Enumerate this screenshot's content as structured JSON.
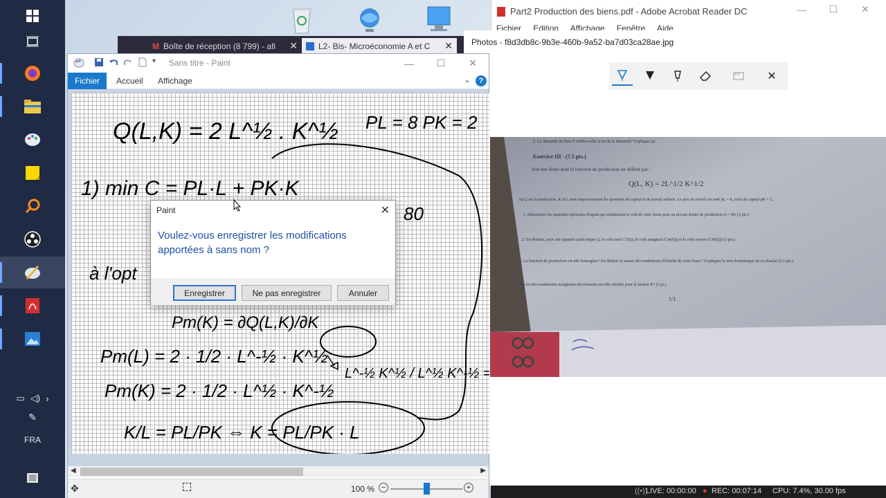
{
  "taskbar": {
    "items": [
      {
        "icon": "windows-start-icon"
      },
      {
        "icon": "task-view-icon"
      },
      {
        "icon": "firefox-icon"
      },
      {
        "icon": "file-explorer-icon"
      },
      {
        "icon": "paint-app-icon"
      },
      {
        "icon": "sticky-notes-icon"
      },
      {
        "icon": "search-magnifier-icon"
      },
      {
        "icon": "obs-studio-icon"
      },
      {
        "icon": "paint-brush-icon"
      },
      {
        "icon": "acrobat-icon"
      },
      {
        "icon": "photos-icon"
      }
    ],
    "language": "FRA"
  },
  "browser": {
    "tabs": [
      {
        "label": "Boîte de réception (8 799) - afi"
      },
      {
        "label": "L2- Bis- Microéconomie A et C"
      }
    ]
  },
  "paint": {
    "title": "Sans titre - Paint",
    "ribbon": {
      "file_label": "Fichier",
      "tabs": [
        "Accueil",
        "Affichage"
      ],
      "help": "?"
    },
    "zoom_label": "100 %",
    "zoom_minus": "−",
    "zoom_plus": "+",
    "canvas": {
      "handwriting": [
        "Q(L,K) = 2 L^½ . K^½",
        "PL = 8    PK = 2",
        "1)   min   C = PL·L + PK·K",
        "80",
        "à l'opt",
        "Pm(K) = ∂Q(L,K)/∂K",
        "Pm(L) = 2 · 1/2 · L^-½ · K^½",
        "Pm(K) = 2 · 1/2 · L^½ · K^-½",
        "L^-½ K^½ / L^½ K^-½  = K / L",
        "K/L = PL/PK  ⇔  K = PL/PK · L"
      ]
    }
  },
  "dialog": {
    "title": "Paint",
    "message": "Voulez-vous enregistrer les modifications apportées à sans nom ?",
    "buttons": {
      "save": "Enregistrer",
      "dont_save": "Ne pas enregistrer",
      "cancel": "Annuler"
    }
  },
  "acrobat": {
    "title": "Part2 Production des biens.pdf - Adobe Acrobat Reader DC",
    "menu": [
      "Fichier",
      "Edition",
      "Affichage",
      "Fenêtre",
      "Aide"
    ]
  },
  "photos": {
    "title": "Photos - f8d3db8c-9b3e-460b-9a52-ba7d03ca28ae.jpg",
    "toolbar": [
      "ballpoint-pen-icon",
      "pencil-icon",
      "calligraphy-pen-icon",
      "eraser-icon",
      "ruler-icon",
      "close-icon"
    ],
    "photo_text": {
      "top_line": "5. La demande du bien Y vérifie-t-elle la loi de la demande? Expliquez pt.",
      "heading": "Exercice III - (7.5 pts.)",
      "intro": "Soit une firme dont la fonction de production est définie par :",
      "formula": "Q(L, K) = 2L^1/2 K^1/2",
      "desc": "où Q est la production, K et L sont respectivement les quantités de capital et de travail utilisée. Le prix du travail est noté pL = 8, celui du capital pK = 2.",
      "q1": "1. Déterminer les quantités optimales d'inputs qui minimisent le coût de cette firme pour un niveau donné de production Q = 80; (2 pts.)",
      "q2": "2. En déduire, pour une quantité quelconque Q, le coût total CT(Q), le coût marginal (Cm(Q)) et le coût moyen (CM(Q)) (2 pts.)",
      "q3": "3. La fonction de production est-elle homogène? En déduire la nature des rendements d'échelle de cette firme ? Expliquer le sens économique de ce résultat (2.5 pts.)",
      "q4": "4. La loi des rendements marginaux décroissants est-elle vérifiée pour le facteur K? (1 pt.)",
      "page": "1/1"
    }
  },
  "recorder": {
    "live": "LIVE: 00:00:00",
    "rec": "REC: 00:07:14",
    "cpu": "CPU: 7.4%, 30.00 fps"
  }
}
